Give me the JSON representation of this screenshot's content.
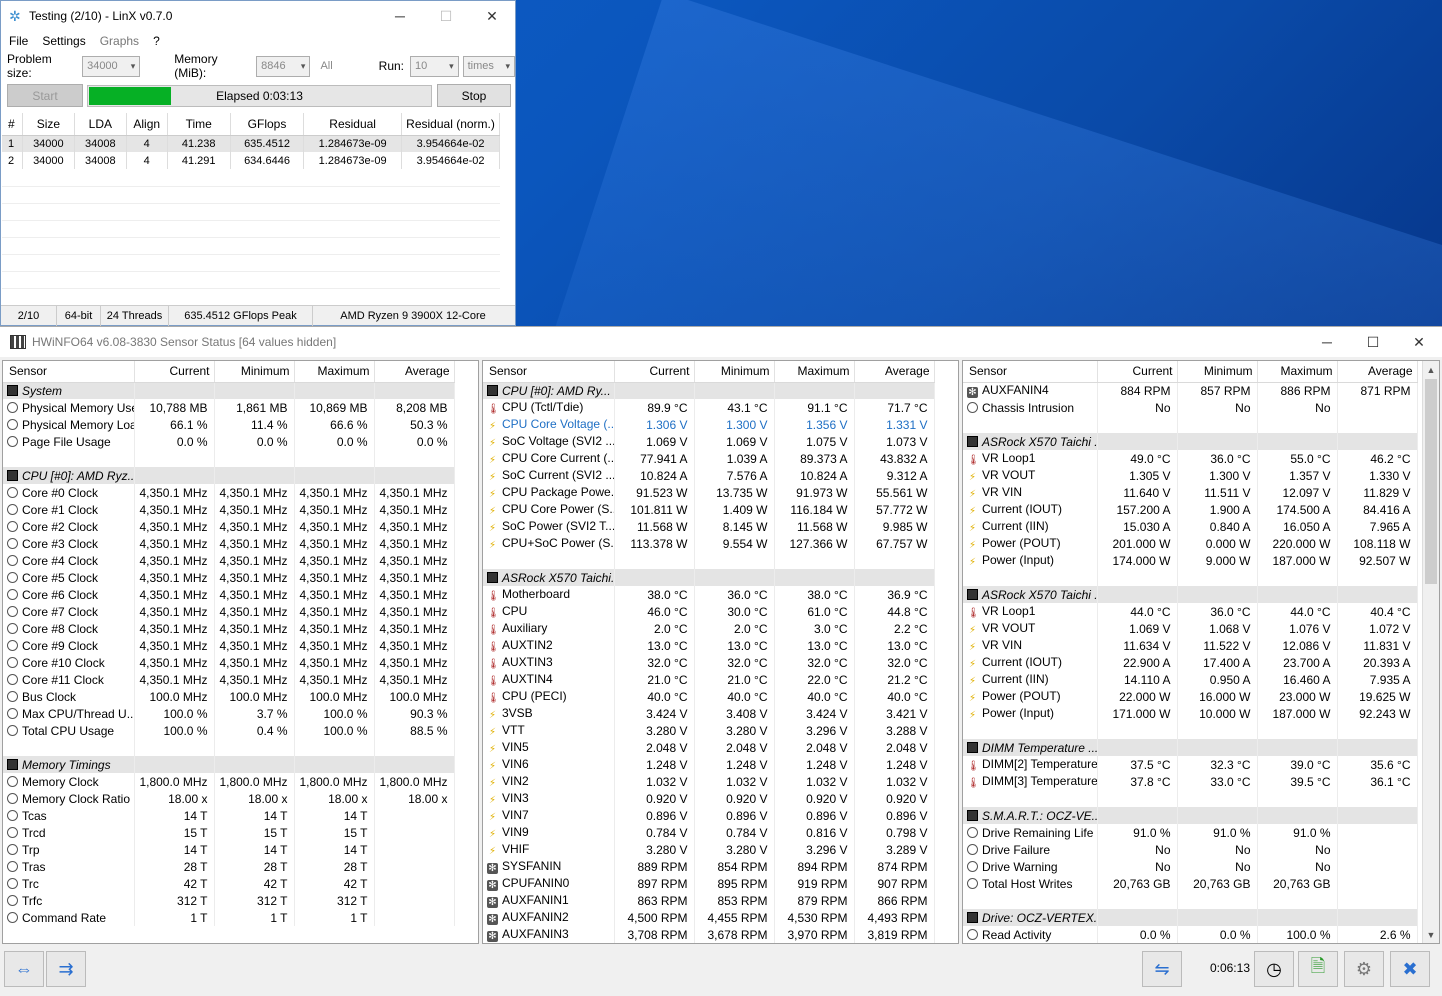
{
  "linx": {
    "title": "Testing (2/10) - LinX v0.7.0",
    "menu": [
      "File",
      "Settings",
      "Graphs",
      "?"
    ],
    "problem_size_label": "Problem size:",
    "problem_size": "34000",
    "memory_label": "Memory (MiB):",
    "memory": "8846",
    "all_label": "All",
    "run_label": "Run:",
    "run": "10",
    "times": "times",
    "start": "Start",
    "elapsed": "Elapsed 0:03:13",
    "progress_fraction": 0.24,
    "stop": "Stop",
    "columns": [
      "#",
      "Size",
      "LDA",
      "Align",
      "Time",
      "GFlops",
      "Residual",
      "Residual (norm.)"
    ],
    "rows": [
      [
        "1",
        "34000",
        "34008",
        "4",
        "41.238",
        "635.4512",
        "1.284673e-09",
        "3.954664e-02"
      ],
      [
        "2",
        "34000",
        "34008",
        "4",
        "41.291",
        "634.6446",
        "1.284673e-09",
        "3.954664e-02"
      ]
    ],
    "status": [
      "2/10",
      "64-bit",
      "24 Threads",
      "635.4512 GFlops Peak",
      "AMD Ryzen 9 3900X 12-Core"
    ]
  },
  "hwinfo": {
    "title": "HWiNFO64 v6.08-3830 Sensor Status [64 values hidden]",
    "columns": [
      "Sensor",
      "Current",
      "Minimum",
      "Maximum",
      "Average"
    ],
    "clock": "0:06:13",
    "panels": [
      [
        {
          "g": "System"
        },
        {
          "i": "clock",
          "n": "Physical Memory Used",
          "v": [
            "10,788 MB",
            "1,861 MB",
            "10,869 MB",
            "8,208 MB"
          ]
        },
        {
          "i": "clock",
          "n": "Physical Memory Load",
          "v": [
            "66.1 %",
            "11.4 %",
            "66.6 %",
            "50.3 %"
          ]
        },
        {
          "i": "clock",
          "n": "Page File Usage",
          "v": [
            "0.0 %",
            "0.0 %",
            "0.0 %",
            "0.0 %"
          ]
        },
        {
          "b": 1
        },
        {
          "g": "CPU [#0]: AMD Ryz..."
        },
        {
          "i": "clock",
          "n": "Core #0 Clock",
          "v": [
            "4,350.1 MHz",
            "4,350.1 MHz",
            "4,350.1 MHz",
            "4,350.1 MHz"
          ]
        },
        {
          "i": "clock",
          "n": "Core #1 Clock",
          "v": [
            "4,350.1 MHz",
            "4,350.1 MHz",
            "4,350.1 MHz",
            "4,350.1 MHz"
          ]
        },
        {
          "i": "clock",
          "n": "Core #2 Clock",
          "v": [
            "4,350.1 MHz",
            "4,350.1 MHz",
            "4,350.1 MHz",
            "4,350.1 MHz"
          ]
        },
        {
          "i": "clock",
          "n": "Core #3 Clock",
          "v": [
            "4,350.1 MHz",
            "4,350.1 MHz",
            "4,350.1 MHz",
            "4,350.1 MHz"
          ]
        },
        {
          "i": "clock",
          "n": "Core #4 Clock",
          "v": [
            "4,350.1 MHz",
            "4,350.1 MHz",
            "4,350.1 MHz",
            "4,350.1 MHz"
          ]
        },
        {
          "i": "clock",
          "n": "Core #5 Clock",
          "v": [
            "4,350.1 MHz",
            "4,350.1 MHz",
            "4,350.1 MHz",
            "4,350.1 MHz"
          ]
        },
        {
          "i": "clock",
          "n": "Core #6 Clock",
          "v": [
            "4,350.1 MHz",
            "4,350.1 MHz",
            "4,350.1 MHz",
            "4,350.1 MHz"
          ]
        },
        {
          "i": "clock",
          "n": "Core #7 Clock",
          "v": [
            "4,350.1 MHz",
            "4,350.1 MHz",
            "4,350.1 MHz",
            "4,350.1 MHz"
          ]
        },
        {
          "i": "clock",
          "n": "Core #8 Clock",
          "v": [
            "4,350.1 MHz",
            "4,350.1 MHz",
            "4,350.1 MHz",
            "4,350.1 MHz"
          ]
        },
        {
          "i": "clock",
          "n": "Core #9 Clock",
          "v": [
            "4,350.1 MHz",
            "4,350.1 MHz",
            "4,350.1 MHz",
            "4,350.1 MHz"
          ]
        },
        {
          "i": "clock",
          "n": "Core #10 Clock",
          "v": [
            "4,350.1 MHz",
            "4,350.1 MHz",
            "4,350.1 MHz",
            "4,350.1 MHz"
          ]
        },
        {
          "i": "clock",
          "n": "Core #11 Clock",
          "v": [
            "4,350.1 MHz",
            "4,350.1 MHz",
            "4,350.1 MHz",
            "4,350.1 MHz"
          ]
        },
        {
          "i": "clock",
          "n": "Bus Clock",
          "v": [
            "100.0 MHz",
            "100.0 MHz",
            "100.0 MHz",
            "100.0 MHz"
          ]
        },
        {
          "i": "clock",
          "n": "Max CPU/Thread U...",
          "v": [
            "100.0 %",
            "3.7 %",
            "100.0 %",
            "90.3 %"
          ]
        },
        {
          "i": "clock",
          "n": "Total CPU Usage",
          "v": [
            "100.0 %",
            "0.4 %",
            "100.0 %",
            "88.5 %"
          ]
        },
        {
          "b": 1
        },
        {
          "g": "Memory Timings"
        },
        {
          "i": "clock",
          "n": "Memory Clock",
          "v": [
            "1,800.0 MHz",
            "1,800.0 MHz",
            "1,800.0 MHz",
            "1,800.0 MHz"
          ]
        },
        {
          "i": "clock",
          "n": "Memory Clock Ratio",
          "v": [
            "18.00 x",
            "18.00 x",
            "18.00 x",
            "18.00 x"
          ]
        },
        {
          "i": "clock",
          "n": "Tcas",
          "v": [
            "14 T",
            "14 T",
            "14 T",
            ""
          ]
        },
        {
          "i": "clock",
          "n": "Trcd",
          "v": [
            "15 T",
            "15 T",
            "15 T",
            ""
          ]
        },
        {
          "i": "clock",
          "n": "Trp",
          "v": [
            "14 T",
            "14 T",
            "14 T",
            ""
          ]
        },
        {
          "i": "clock",
          "n": "Tras",
          "v": [
            "28 T",
            "28 T",
            "28 T",
            ""
          ]
        },
        {
          "i": "clock",
          "n": "Trc",
          "v": [
            "42 T",
            "42 T",
            "42 T",
            ""
          ]
        },
        {
          "i": "clock",
          "n": "Trfc",
          "v": [
            "312 T",
            "312 T",
            "312 T",
            ""
          ]
        },
        {
          "i": "clock",
          "n": "Command Rate",
          "v": [
            "1 T",
            "1 T",
            "1 T",
            ""
          ]
        }
      ],
      [
        {
          "g": "CPU [#0]: AMD Ry..."
        },
        {
          "i": "therm",
          "n": "CPU (Tctl/Tdie)",
          "v": [
            "89.9 °C",
            "43.1 °C",
            "91.1 °C",
            "71.7 °C"
          ]
        },
        {
          "i": "bolt",
          "n": "CPU Core Voltage (...",
          "v": [
            "1.306 V",
            "1.300 V",
            "1.356 V",
            "1.331 V"
          ],
          "hl": 1
        },
        {
          "i": "bolt",
          "n": "SoC Voltage (SVI2 ...",
          "v": [
            "1.069 V",
            "1.069 V",
            "1.075 V",
            "1.073 V"
          ]
        },
        {
          "i": "bolt",
          "n": "CPU Core Current (...",
          "v": [
            "77.941 A",
            "1.039 A",
            "89.373 A",
            "43.832 A"
          ]
        },
        {
          "i": "bolt",
          "n": "SoC Current (SVI2 ...",
          "v": [
            "10.824 A",
            "7.576 A",
            "10.824 A",
            "9.312 A"
          ]
        },
        {
          "i": "bolt",
          "n": "CPU Package Powe...",
          "v": [
            "91.523 W",
            "13.735 W",
            "91.973 W",
            "55.561 W"
          ]
        },
        {
          "i": "bolt",
          "n": "CPU Core Power (S...",
          "v": [
            "101.811 W",
            "1.409 W",
            "116.184 W",
            "57.772 W"
          ]
        },
        {
          "i": "bolt",
          "n": "SoC Power (SVI2 T...",
          "v": [
            "11.568 W",
            "8.145 W",
            "11.568 W",
            "9.985 W"
          ]
        },
        {
          "i": "bolt",
          "n": "CPU+SoC Power (S...",
          "v": [
            "113.378 W",
            "9.554 W",
            "127.366 W",
            "67.757 W"
          ]
        },
        {
          "b": 1
        },
        {
          "g": "ASRock X570 Taichi..."
        },
        {
          "i": "therm",
          "n": "Motherboard",
          "v": [
            "38.0 °C",
            "36.0 °C",
            "38.0 °C",
            "36.9 °C"
          ]
        },
        {
          "i": "therm",
          "n": "CPU",
          "v": [
            "46.0 °C",
            "30.0 °C",
            "61.0 °C",
            "44.8 °C"
          ]
        },
        {
          "i": "therm",
          "n": "Auxiliary",
          "v": [
            "2.0 °C",
            "2.0 °C",
            "3.0 °C",
            "2.2 °C"
          ]
        },
        {
          "i": "therm",
          "n": "AUXTIN2",
          "v": [
            "13.0 °C",
            "13.0 °C",
            "13.0 °C",
            "13.0 °C"
          ]
        },
        {
          "i": "therm",
          "n": "AUXTIN3",
          "v": [
            "32.0 °C",
            "32.0 °C",
            "32.0 °C",
            "32.0 °C"
          ]
        },
        {
          "i": "therm",
          "n": "AUXTIN4",
          "v": [
            "21.0 °C",
            "21.0 °C",
            "22.0 °C",
            "21.2 °C"
          ]
        },
        {
          "i": "therm",
          "n": "CPU (PECI)",
          "v": [
            "40.0 °C",
            "40.0 °C",
            "40.0 °C",
            "40.0 °C"
          ]
        },
        {
          "i": "bolt",
          "n": "3VSB",
          "v": [
            "3.424 V",
            "3.408 V",
            "3.424 V",
            "3.421 V"
          ]
        },
        {
          "i": "bolt",
          "n": "VTT",
          "v": [
            "3.280 V",
            "3.280 V",
            "3.296 V",
            "3.288 V"
          ]
        },
        {
          "i": "bolt",
          "n": "VIN5",
          "v": [
            "2.048 V",
            "2.048 V",
            "2.048 V",
            "2.048 V"
          ]
        },
        {
          "i": "bolt",
          "n": "VIN6",
          "v": [
            "1.248 V",
            "1.248 V",
            "1.248 V",
            "1.248 V"
          ]
        },
        {
          "i": "bolt",
          "n": "VIN2",
          "v": [
            "1.032 V",
            "1.032 V",
            "1.032 V",
            "1.032 V"
          ]
        },
        {
          "i": "bolt",
          "n": "VIN3",
          "v": [
            "0.920 V",
            "0.920 V",
            "0.920 V",
            "0.920 V"
          ]
        },
        {
          "i": "bolt",
          "n": "VIN7",
          "v": [
            "0.896 V",
            "0.896 V",
            "0.896 V",
            "0.896 V"
          ]
        },
        {
          "i": "bolt",
          "n": "VIN9",
          "v": [
            "0.784 V",
            "0.784 V",
            "0.816 V",
            "0.798 V"
          ]
        },
        {
          "i": "bolt",
          "n": "VHIF",
          "v": [
            "3.280 V",
            "3.280 V",
            "3.296 V",
            "3.289 V"
          ]
        },
        {
          "i": "fan",
          "n": "SYSFANIN",
          "v": [
            "889 RPM",
            "854 RPM",
            "894 RPM",
            "874 RPM"
          ]
        },
        {
          "i": "fan",
          "n": "CPUFANIN0",
          "v": [
            "897 RPM",
            "895 RPM",
            "919 RPM",
            "907 RPM"
          ]
        },
        {
          "i": "fan",
          "n": "AUXFANIN1",
          "v": [
            "863 RPM",
            "853 RPM",
            "879 RPM",
            "866 RPM"
          ]
        },
        {
          "i": "fan",
          "n": "AUXFANIN2",
          "v": [
            "4,500 RPM",
            "4,455 RPM",
            "4,530 RPM",
            "4,493 RPM"
          ]
        },
        {
          "i": "fan",
          "n": "AUXFANIN3",
          "v": [
            "3,708 RPM",
            "3,678 RPM",
            "3,970 RPM",
            "3,819 RPM"
          ]
        }
      ],
      [
        {
          "i": "fan",
          "n": "AUXFANIN4",
          "v": [
            "884 RPM",
            "857 RPM",
            "886 RPM",
            "871 RPM"
          ]
        },
        {
          "i": "clock",
          "n": "Chassis Intrusion",
          "v": [
            "No",
            "No",
            "No",
            ""
          ]
        },
        {
          "b": 1
        },
        {
          "g": "ASRock X570 Taichi ..."
        },
        {
          "i": "therm",
          "n": "VR Loop1",
          "v": [
            "49.0 °C",
            "36.0 °C",
            "55.0 °C",
            "46.2 °C"
          ]
        },
        {
          "i": "bolt",
          "n": "VR VOUT",
          "v": [
            "1.305 V",
            "1.300 V",
            "1.357 V",
            "1.330 V"
          ]
        },
        {
          "i": "bolt",
          "n": "VR VIN",
          "v": [
            "11.640 V",
            "11.511 V",
            "12.097 V",
            "11.829 V"
          ]
        },
        {
          "i": "bolt",
          "n": "Current (IOUT)",
          "v": [
            "157.200 A",
            "1.900 A",
            "174.500 A",
            "84.416 A"
          ]
        },
        {
          "i": "bolt",
          "n": "Current (IIN)",
          "v": [
            "15.030 A",
            "0.840 A",
            "16.050 A",
            "7.965 A"
          ]
        },
        {
          "i": "bolt",
          "n": "Power (POUT)",
          "v": [
            "201.000 W",
            "0.000 W",
            "220.000 W",
            "108.118 W"
          ]
        },
        {
          "i": "bolt",
          "n": "Power (Input)",
          "v": [
            "174.000 W",
            "9.000 W",
            "187.000 W",
            "92.507 W"
          ]
        },
        {
          "b": 1
        },
        {
          "g": "ASRock X570 Taichi ..."
        },
        {
          "i": "therm",
          "n": "VR Loop1",
          "v": [
            "44.0 °C",
            "36.0 °C",
            "44.0 °C",
            "40.4 °C"
          ]
        },
        {
          "i": "bolt",
          "n": "VR VOUT",
          "v": [
            "1.069 V",
            "1.068 V",
            "1.076 V",
            "1.072 V"
          ]
        },
        {
          "i": "bolt",
          "n": "VR VIN",
          "v": [
            "11.634 V",
            "11.522 V",
            "12.086 V",
            "11.831 V"
          ]
        },
        {
          "i": "bolt",
          "n": "Current (IOUT)",
          "v": [
            "22.900 A",
            "17.400 A",
            "23.700 A",
            "20.393 A"
          ]
        },
        {
          "i": "bolt",
          "n": "Current (IIN)",
          "v": [
            "14.110 A",
            "0.950 A",
            "16.460 A",
            "7.935 A"
          ]
        },
        {
          "i": "bolt",
          "n": "Power (POUT)",
          "v": [
            "22.000 W",
            "16.000 W",
            "23.000 W",
            "19.625 W"
          ]
        },
        {
          "i": "bolt",
          "n": "Power (Input)",
          "v": [
            "171.000 W",
            "10.000 W",
            "187.000 W",
            "92.243 W"
          ]
        },
        {
          "b": 1
        },
        {
          "g": "DIMM Temperature ..."
        },
        {
          "i": "therm",
          "n": "DIMM[2] Temperature",
          "v": [
            "37.5 °C",
            "32.3 °C",
            "39.0 °C",
            "35.6 °C"
          ]
        },
        {
          "i": "therm",
          "n": "DIMM[3] Temperature",
          "v": [
            "37.8 °C",
            "33.0 °C",
            "39.5 °C",
            "36.1 °C"
          ]
        },
        {
          "b": 1
        },
        {
          "g": "S.M.A.R.T.: OCZ-VE..."
        },
        {
          "i": "clock",
          "n": "Drive Remaining Life",
          "v": [
            "91.0 %",
            "91.0 %",
            "91.0 %",
            ""
          ]
        },
        {
          "i": "clock",
          "n": "Drive Failure",
          "v": [
            "No",
            "No",
            "No",
            ""
          ]
        },
        {
          "i": "clock",
          "n": "Drive Warning",
          "v": [
            "No",
            "No",
            "No",
            ""
          ]
        },
        {
          "i": "clock",
          "n": "Total Host Writes",
          "v": [
            "20,763 GB",
            "20,763 GB",
            "20,763 GB",
            ""
          ]
        },
        {
          "b": 1
        },
        {
          "g": "Drive: OCZ-VERTEX..."
        },
        {
          "i": "clock",
          "n": "Read Activity",
          "v": [
            "0.0 %",
            "0.0 %",
            "100.0 %",
            "2.6 %"
          ]
        }
      ]
    ]
  }
}
